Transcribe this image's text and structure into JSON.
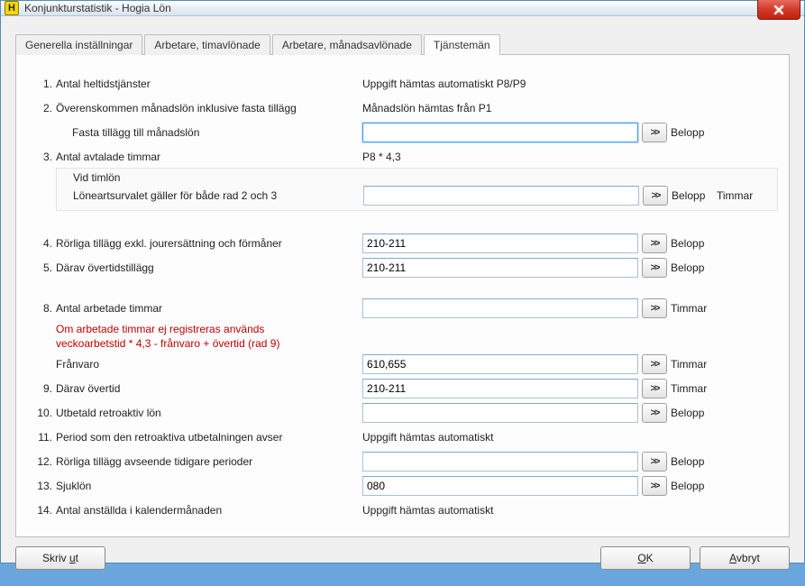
{
  "window": {
    "title": "Konjunkturstatistik - Hogia Lön",
    "icon_letter": "H"
  },
  "tabs": [
    {
      "label": "Generella inställningar",
      "active": false
    },
    {
      "label": "Arbetare, timavlönade",
      "active": false
    },
    {
      "label": "Arbetare, månadsavlönade",
      "active": false
    },
    {
      "label": "Tjänstemän",
      "active": true
    }
  ],
  "rows": {
    "r1": {
      "num": "1.",
      "label": "Antal heltidstjänster",
      "static": "Uppgift hämtas automatiskt P8/P9"
    },
    "r2": {
      "num": "2.",
      "label": "Överenskommen månadslön inklusive fasta tillägg",
      "static": "Månadslön hämtas från P1"
    },
    "r2b": {
      "label": "Fasta tillägg till månadslön",
      "value": "",
      "unit": "Belopp",
      "focused": true
    },
    "r3": {
      "num": "3.",
      "label": "Antal avtalade timmar",
      "static": "P8 * 4,3"
    },
    "r3i": {
      "label_top": "Vid timlön",
      "label": "Löneartsurvalet gäller för både rad 2 och 3",
      "value": "",
      "unit1": "Belopp",
      "unit2": "Timmar"
    },
    "r4": {
      "num": "4.",
      "label": "Rörliga tillägg exkl. jourersättning och förmåner",
      "value": "210-211",
      "unit": "Belopp"
    },
    "r5": {
      "num": "5.",
      "label": "Därav övertidstillägg",
      "value": "210-211",
      "unit": "Belopp"
    },
    "r8": {
      "num": "8.",
      "label": "Antal arbetade timmar",
      "value": "",
      "unit": "Timmar"
    },
    "note": {
      "line1": "Om arbetade timmar ej registreras används",
      "line2": "veckoarbetstid * 4,3 - frånvaro + övertid (rad 9)"
    },
    "r8b": {
      "label": "Frånvaro",
      "value": "610,655",
      "unit": "Timmar"
    },
    "r9": {
      "num": "9.",
      "label": "Därav övertid",
      "value": "210-211",
      "unit": "Timmar"
    },
    "r10": {
      "num": "10.",
      "label": "Utbetald retroaktiv lön",
      "value": "",
      "unit": "Belopp"
    },
    "r11": {
      "num": "11.",
      "label": "Period som den retroaktiva utbetalningen avser",
      "static": "Uppgift hämtas automatiskt"
    },
    "r12": {
      "num": "12.",
      "label": "Rörliga tillägg avseende tidigare perioder",
      "value": "",
      "unit": "Belopp"
    },
    "r13": {
      "num": "13.",
      "label": "Sjuklön",
      "value": "080",
      "unit": "Belopp"
    },
    "r14": {
      "num": "14.",
      "label": "Antal anställda i kalendermånaden",
      "static": "Uppgift hämtas automatiskt"
    }
  },
  "buttons": {
    "print_pre": "Skriv ",
    "print_m": "u",
    "print_post": "t",
    "ok_pre": "",
    "ok_m": "O",
    "ok_post": "K",
    "cancel_pre": "",
    "cancel_m": "A",
    "cancel_post": "vbryt"
  },
  "arrow_glyph": ">>"
}
